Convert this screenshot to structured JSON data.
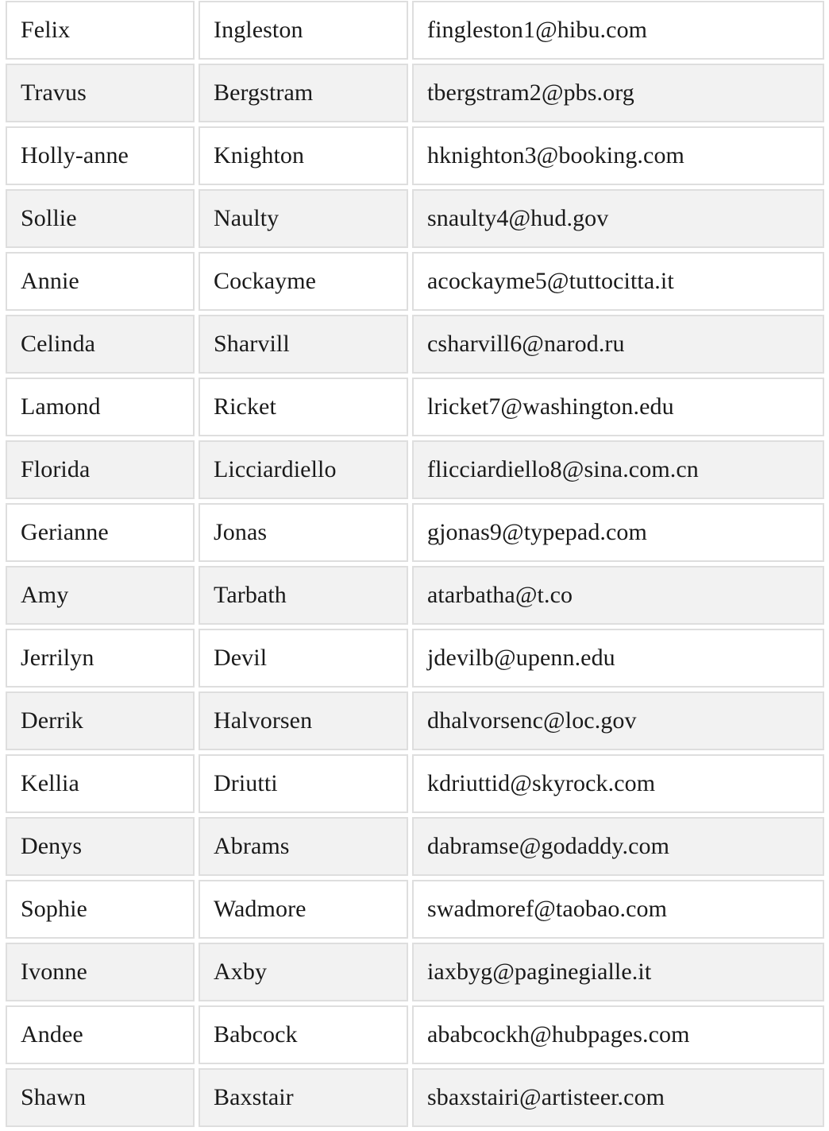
{
  "table": {
    "rows": [
      {
        "first": "Felix",
        "last": "Ingleston",
        "email": "fingleston1@hibu.com"
      },
      {
        "first": "Travus",
        "last": "Bergstram",
        "email": "tbergstram2@pbs.org"
      },
      {
        "first": "Holly-anne",
        "last": "Knighton",
        "email": "hknighton3@booking.com"
      },
      {
        "first": "Sollie",
        "last": "Naulty",
        "email": "snaulty4@hud.gov"
      },
      {
        "first": "Annie",
        "last": "Cockayme",
        "email": "acockayme5@tuttocitta.it"
      },
      {
        "first": "Celinda",
        "last": "Sharvill",
        "email": "csharvill6@narod.ru"
      },
      {
        "first": "Lamond",
        "last": "Ricket",
        "email": "lricket7@washington.edu"
      },
      {
        "first": "Florida",
        "last": "Licciardiello",
        "email": "flicciardiello8@sina.com.cn"
      },
      {
        "first": "Gerianne",
        "last": "Jonas",
        "email": "gjonas9@typepad.com"
      },
      {
        "first": "Amy",
        "last": "Tarbath",
        "email": "atarbatha@t.co"
      },
      {
        "first": "Jerrilyn",
        "last": "Devil",
        "email": "jdevilb@upenn.edu"
      },
      {
        "first": "Derrik",
        "last": "Halvorsen",
        "email": "dhalvorsenc@loc.gov"
      },
      {
        "first": "Kellia",
        "last": "Driutti",
        "email": "kdriuttid@skyrock.com"
      },
      {
        "first": "Denys",
        "last": "Abrams",
        "email": "dabramse@godaddy.com"
      },
      {
        "first": "Sophie",
        "last": "Wadmore",
        "email": "swadmoref@taobao.com"
      },
      {
        "first": "Ivonne",
        "last": "Axby",
        "email": "iaxbyg@paginegialle.it"
      },
      {
        "first": "Andee",
        "last": "Babcock",
        "email": "ababcockh@hubpages.com"
      },
      {
        "first": "Shawn",
        "last": "Baxstair",
        "email": "sbaxstairi@artisteer.com"
      }
    ]
  },
  "colors": {
    "border": "#dedede",
    "stripe": "#f2f2f2",
    "text": "#1a1a1a"
  }
}
